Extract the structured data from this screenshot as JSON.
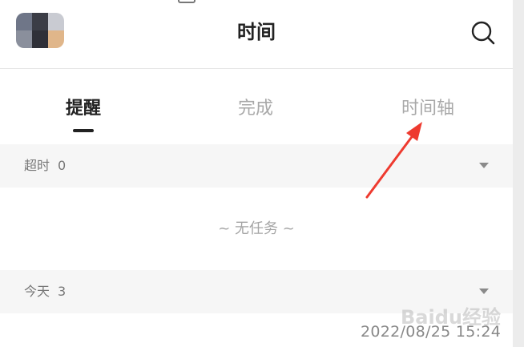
{
  "header": {
    "title": "时间",
    "avatar_colors": [
      "#6f7688",
      "#3b3d46",
      "#c9cbd2",
      "#8a8f9c",
      "#2f3038",
      "#e0b68a"
    ]
  },
  "tabs": [
    {
      "label": "提醒",
      "active": true
    },
    {
      "label": "完成",
      "active": false
    },
    {
      "label": "时间轴",
      "active": false
    }
  ],
  "sections": {
    "overdue": {
      "label": "超时",
      "count": "0"
    },
    "today": {
      "label": "今天",
      "count": "3"
    }
  },
  "empty_state": "~ 无任务 ~",
  "task_timestamp": "2022/08/25 15:24",
  "annotation": {
    "color": "#ee3a2f"
  },
  "watermark": "Baidu经验"
}
